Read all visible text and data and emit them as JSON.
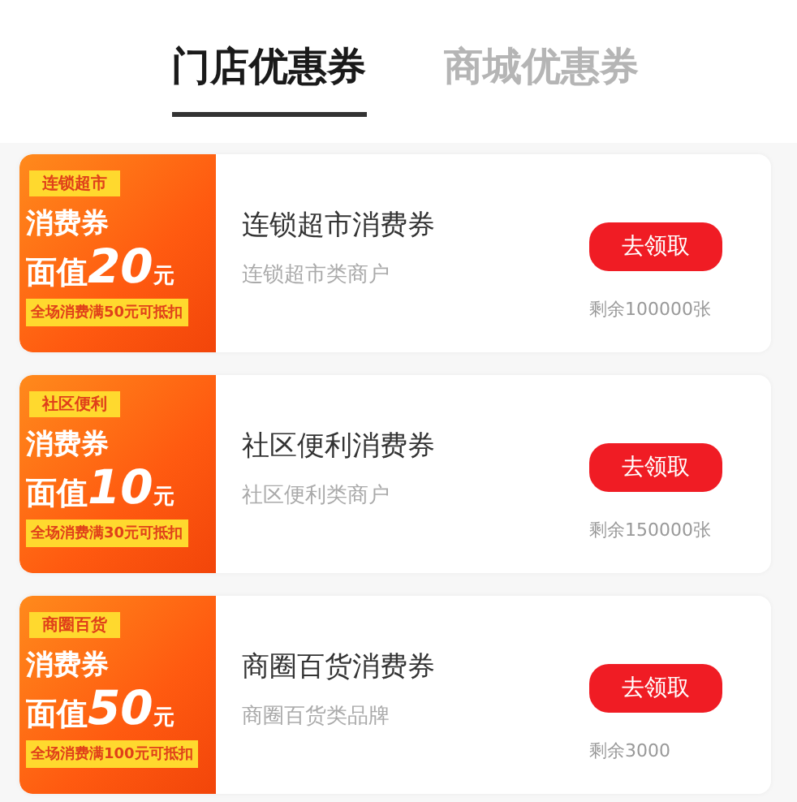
{
  "tabs": [
    {
      "label": "门店优惠券",
      "selected": true
    },
    {
      "label": "商城优惠券",
      "selected": false
    }
  ],
  "coupons": [
    {
      "tag": "连锁超市",
      "heading": "消费券",
      "value_prefix": "面值",
      "value": "20",
      "unit": "元",
      "condition": "全场消费满50元可抵扣",
      "title": "连锁超市消费券",
      "subtitle": "连锁超市类商户",
      "button": "去领取",
      "remaining": "剩余100000张"
    },
    {
      "tag": "社区便利",
      "heading": "消费券",
      "value_prefix": "面值",
      "value": "10",
      "unit": "元",
      "condition": "全场消费满30元可抵扣",
      "title": "社区便利消费券",
      "subtitle": "社区便利类商户",
      "button": "去领取",
      "remaining": "剩余150000张"
    },
    {
      "tag": "商圈百货",
      "heading": "消费券",
      "value_prefix": "面值",
      "value": "50",
      "unit": "元",
      "condition": "全场消费满100元可抵扣",
      "title": "商圈百货消费券",
      "subtitle": "商圈百货类品牌",
      "button": "去领取",
      "remaining": "剩余3000"
    }
  ]
}
